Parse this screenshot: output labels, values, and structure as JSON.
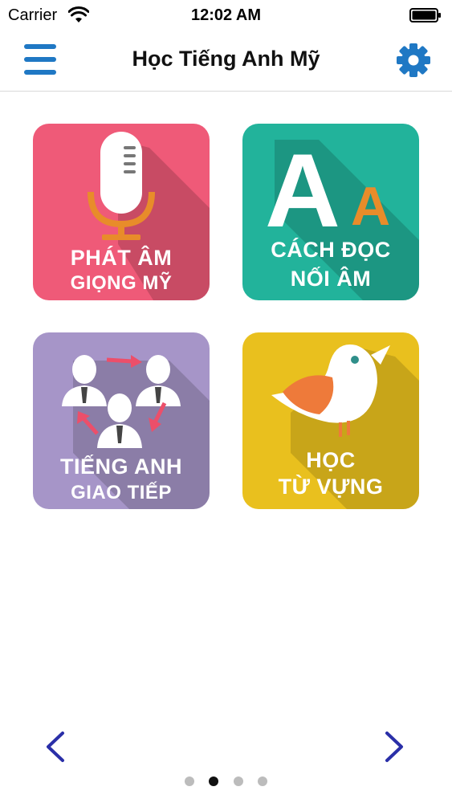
{
  "status_bar": {
    "carrier": "Carrier",
    "time": "12:02 AM"
  },
  "header": {
    "title": "Học Tiếng Anh Mỹ",
    "menu_icon": "hamburger-menu-icon",
    "settings_icon": "gear-icon"
  },
  "tiles": [
    {
      "id": "phat-am",
      "line1": "PHÁT ÂM",
      "line2": "GIỌNG MỸ",
      "icon": "microphone-icon",
      "color": "#ef5a78"
    },
    {
      "id": "cach-doc",
      "line1": "CÁCH ĐỌC",
      "line2": "NỐI ÂM",
      "glyph_big": "A",
      "glyph_small": "A",
      "icon": "letters-icon",
      "color": "#22b39b"
    },
    {
      "id": "tieng-anh",
      "line1": "TIẾNG ANH",
      "line2": "GIAO TIẾP",
      "icon": "people-conversation-icon",
      "color": "#a695c8"
    },
    {
      "id": "hoc-tu-vung",
      "line1": "HỌC",
      "line2": "TỪ VỰNG",
      "icon": "bird-icon",
      "color": "#e9c01e"
    }
  ],
  "pager": {
    "page_count": 4,
    "active_index": 1,
    "prev_icon": "chevron-left-icon",
    "next_icon": "chevron-right-icon",
    "accent": "#2a2fa8"
  }
}
